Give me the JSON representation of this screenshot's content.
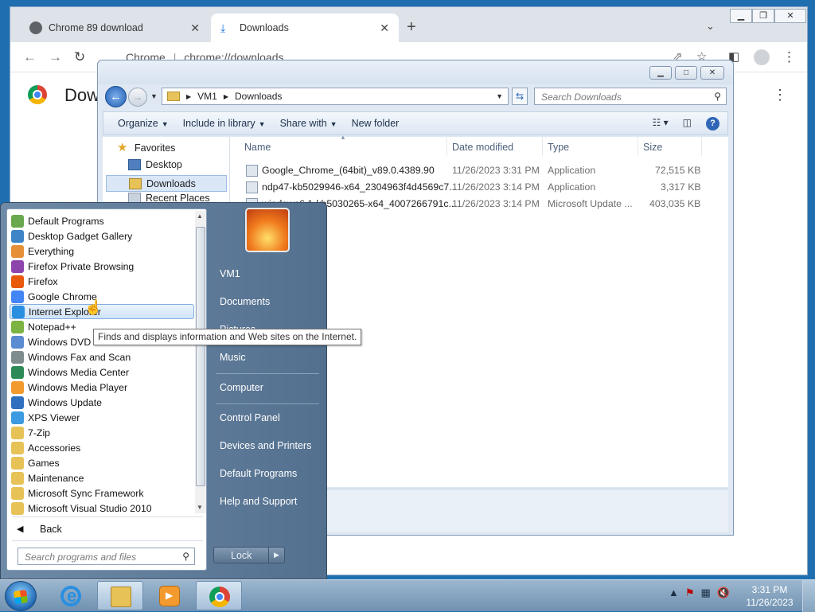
{
  "chrome": {
    "tabs": [
      {
        "title": "Chrome 89 download"
      },
      {
        "title": "Downloads"
      }
    ],
    "new_tab": "+",
    "omnibox_site": "Chrome",
    "omnibox_url": "chrome://downloads",
    "page_title": "Dow"
  },
  "explorer": {
    "breadcrumb": [
      "VM1",
      "Downloads"
    ],
    "search_placeholder": "Search Downloads",
    "commands": [
      "Organize",
      "Include in library",
      "Share with",
      "New folder"
    ],
    "nav": [
      {
        "label": "Favorites",
        "icon": "star-icon"
      },
      {
        "label": "Desktop",
        "icon": "desktop-icon"
      },
      {
        "label": "Downloads",
        "icon": "downloads-folder-icon"
      },
      {
        "label": "Recent Places",
        "icon": "recent-places-icon"
      }
    ],
    "columns": [
      "Name",
      "Date modified",
      "Type",
      "Size"
    ],
    "files": [
      {
        "name": "Google_Chrome_(64bit)_v89.0.4389.90",
        "modified": "11/26/2023 3:31 PM",
        "type": "Application",
        "size": "72,515 KB"
      },
      {
        "name": "ndp47-kb5029946-x64_2304963f4d4569c7...",
        "modified": "11/26/2023 3:14 PM",
        "type": "Application",
        "size": "3,317 KB"
      },
      {
        "name": "windows6.1-kb5030265-x64_4007266791c...",
        "modified": "11/26/2023 3:14 PM",
        "type": "Microsoft Update ...",
        "size": "403,035 KB"
      }
    ]
  },
  "start_menu": {
    "programs": [
      {
        "label": "Default Programs",
        "color": "#6aa84f"
      },
      {
        "label": "Desktop Gadget Gallery",
        "color": "#3d85c6"
      },
      {
        "label": "Everything",
        "color": "#e69138"
      },
      {
        "label": "Firefox Private Browsing",
        "color": "#8e44ad"
      },
      {
        "label": "Firefox",
        "color": "#e8590c"
      },
      {
        "label": "Google Chrome",
        "color": "#4285f4"
      },
      {
        "label": "Internet Explorer",
        "color": "#2a8fe0"
      },
      {
        "label": "Notepad++",
        "color": "#7cb342"
      },
      {
        "label": "Windows DVD Maker",
        "color": "#5b8bd0"
      },
      {
        "label": "Windows Fax and Scan",
        "color": "#7f8c8d"
      },
      {
        "label": "Windows Media Center",
        "color": "#2e8b57"
      },
      {
        "label": "Windows Media Player",
        "color": "#f39a2f"
      },
      {
        "label": "Windows Update",
        "color": "#2f6fbf"
      },
      {
        "label": "XPS Viewer",
        "color": "#3b9ae1"
      },
      {
        "label": "7-Zip",
        "color": "#e7c257"
      },
      {
        "label": "Accessories",
        "color": "#e7c257"
      },
      {
        "label": "Games",
        "color": "#e7c257"
      },
      {
        "label": "Maintenance",
        "color": "#e7c257"
      },
      {
        "label": "Microsoft Sync Framework",
        "color": "#e7c257"
      },
      {
        "label": "Microsoft Visual Studio 2010",
        "color": "#e7c257"
      }
    ],
    "back": "Back",
    "search_placeholder": "Search programs and files",
    "right_links": [
      "VM1",
      "Documents",
      "Pictures",
      "Music",
      "Computer",
      "Control Panel",
      "Devices and Printers",
      "Default Programs",
      "Help and Support"
    ],
    "lock": "Lock"
  },
  "tooltip": "Finds and displays information and Web sites on the Internet.",
  "taskbar": {
    "time": "3:31 PM",
    "date": "11/26/2023"
  }
}
